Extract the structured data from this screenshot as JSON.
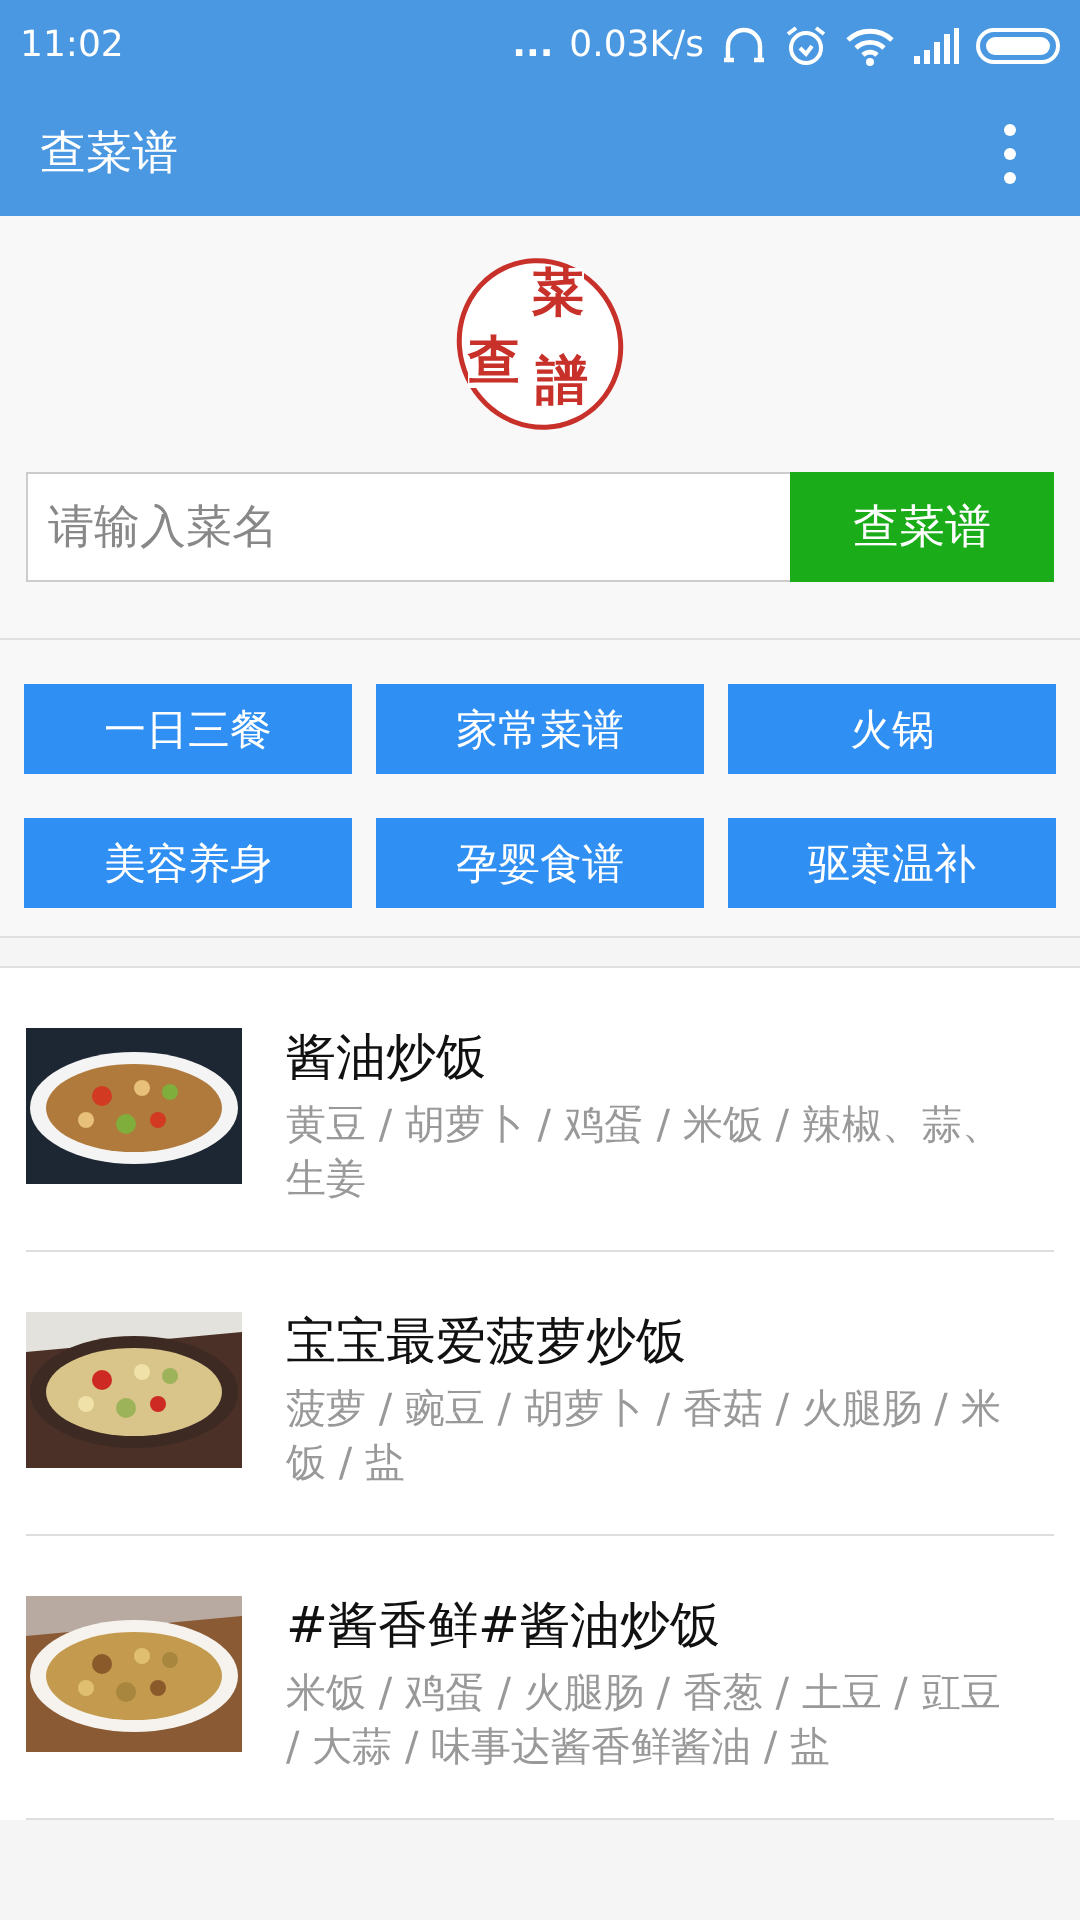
{
  "status_bar": {
    "time": "11:02",
    "dots": "...",
    "speed": "0.03K/s"
  },
  "app_bar": {
    "title": "查菜谱"
  },
  "logo": {
    "chars": [
      "菜",
      "查",
      "譜"
    ]
  },
  "search": {
    "placeholder": "请输入菜名",
    "button": "查菜谱"
  },
  "categories": [
    "一日三餐",
    "家常菜谱",
    "火锅",
    "美容养身",
    "孕婴食谱",
    "驱寒温补"
  ],
  "recipes": [
    {
      "title": "酱油炒饭",
      "ingredients": "黄豆 / 胡萝卜 / 鸡蛋 / 米饭 / 辣椒、蒜、生姜"
    },
    {
      "title": "宝宝最爱菠萝炒饭",
      "ingredients": "菠萝 / 豌豆 / 胡萝卜 / 香菇 / 火腿肠 / 米饭 / 盐"
    },
    {
      "title": "#酱香鲜#酱油炒饭",
      "ingredients": "米饭 / 鸡蛋 / 火腿肠 / 香葱 / 土豆 / 豇豆 / 大蒜 / 味事达酱香鲜酱油 / 盐"
    }
  ]
}
